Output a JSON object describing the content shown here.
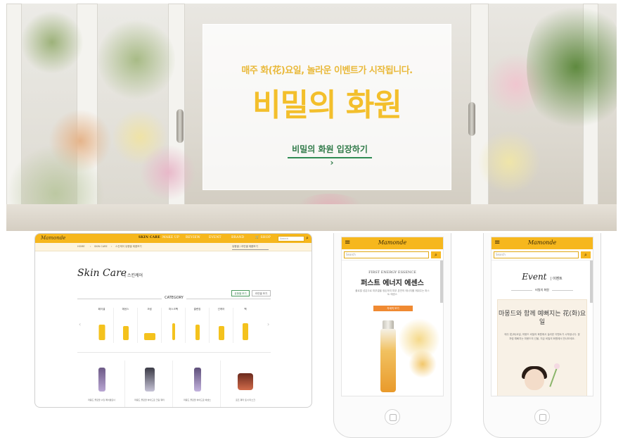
{
  "colors": {
    "brand_yellow": "#f6b71d",
    "title_yellow": "#f3bf2c",
    "link_green": "#2f7a48",
    "orange_button": "#f08a32"
  },
  "hero": {
    "subtitle": "매주 화(花)요일, 놀라운 이벤트가 시작됩니다.",
    "title": "비밀의 화원",
    "link_label": "비밀의 화원 입장하기",
    "link_arrow": "›"
  },
  "desktop": {
    "logo": "Mamonde",
    "nav": [
      "SKIN CARE",
      "MAKE UP",
      "REVIEW",
      "EVENT",
      "BRAND",
      "SHOP"
    ],
    "search_placeholder": "Search",
    "breadcrumb": [
      "HOME",
      "SKIN CARE",
      "스킨케어 유형별 제품보기"
    ],
    "breadcrumb_select": "유형별 / 라인별 제품보기",
    "heading": "Skin Care",
    "heading_ko": "스킨케어",
    "view_buttons": [
      "유형별 보기",
      "라인별 보기"
    ],
    "category_label": "CATEGORY",
    "categories": [
      "페이셜",
      "에센스",
      "크림",
      "마스크팩",
      "클렌징",
      "선케어",
      "팩"
    ],
    "products": [
      "마몽드 플로랄 수딩 페이셜토너",
      "마몽드 플로랄 하이드로 크림 워터",
      "마몽드 플로랄 하이드로 에센스",
      "로즈 워터 토너 마스크"
    ]
  },
  "phone1": {
    "logo": "Mamonde",
    "search_placeholder": "Search",
    "title_en": "FIRST ENERGY ESSENCE",
    "title_ko": "퍼스트 에너지 에센스",
    "desc": "플로랄 성분으로 피부결을 정돈하여 피부 본연의 에너지를 깨워주는 퍼스트 에센스",
    "button": "자세히 보기"
  },
  "phone2": {
    "logo": "Mamonde",
    "search_placeholder": "Search",
    "title_en": "Event",
    "title_ko": "이벤트",
    "subtitle": "비밀의 화원",
    "card_title": "마몽드와 함께 예뻐지는 花(화)요일",
    "card_text": "매주 花(화)요일, 마몽드 비밀의 화원에서 놀라운 이벤트가 시작됩니다. 꽃처럼 예뻐지는 마몽드의 선물, 지금 비밀의 화원에서 만나보세요."
  }
}
